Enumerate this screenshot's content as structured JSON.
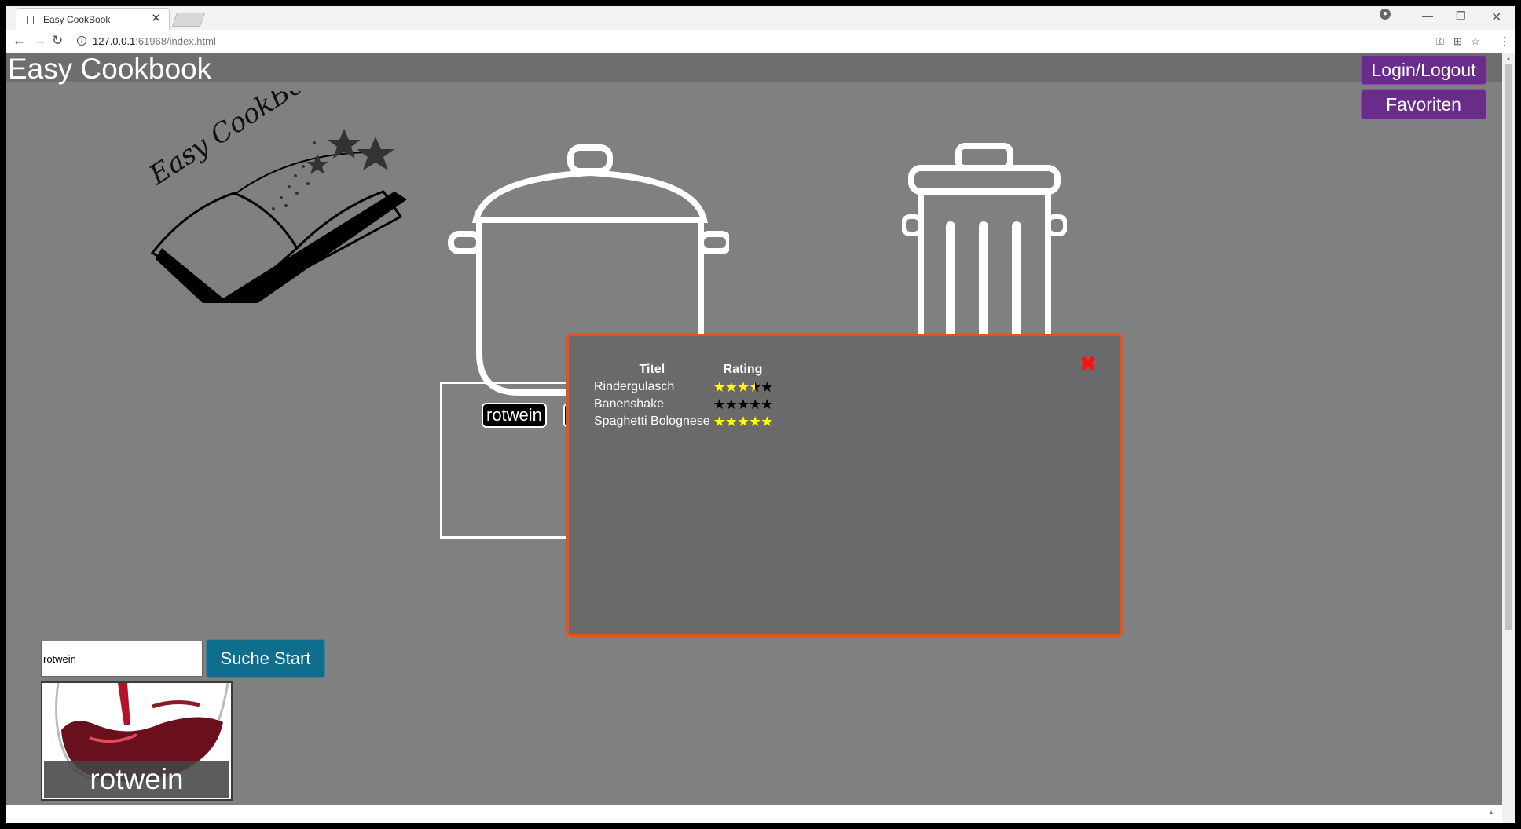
{
  "browser": {
    "tab_title": "Easy CookBook",
    "tab_close": "✕",
    "url_host": "127.0.0.1",
    "url_rest": ":61968/index.html",
    "win_min": "—",
    "win_max": "❐",
    "win_close": "✕"
  },
  "site": {
    "title": "Easy Cookbook",
    "login_label": "Login/Logout",
    "favorites_label": "Favoriten",
    "logo_text": "Easy CookBook"
  },
  "ingredients": {
    "chip": "rotwein"
  },
  "modal": {
    "close_glyph": "✖",
    "col_title": "Titel",
    "col_rating": "Rating",
    "rows": [
      {
        "title": "Rindergulasch",
        "rating": 3.5
      },
      {
        "title": "Banenshake",
        "rating": 0
      },
      {
        "title": "Spaghetti Bolognese",
        "rating": 5
      }
    ],
    "max_rating": 5,
    "star_glyphs": "★★★★★"
  },
  "search": {
    "value": "rotwein",
    "button_label": "Suche Start"
  },
  "result": {
    "label": "rotwein"
  },
  "colors": {
    "page_bg": "#808080",
    "accent_purple": "#6a2c8a",
    "search_button": "#0e6e8c",
    "modal_border": "#e8501c",
    "star_fill": "#ffff00"
  }
}
